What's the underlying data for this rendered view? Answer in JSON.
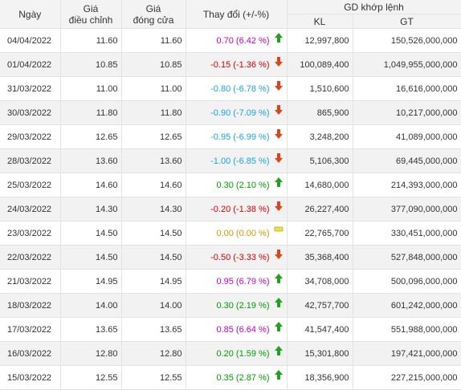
{
  "headers": {
    "date": "Ngày",
    "adj": [
      "Giá",
      "điều chỉnh"
    ],
    "close": [
      "Giá",
      "đóng cửa"
    ],
    "change": "Thay đổi (+/-%)",
    "matched": "GD khớp lệnh",
    "kl": "KL",
    "gt": "GT"
  },
  "colors": {
    "up": "#00a000",
    "down": "#dd0000",
    "ceiling": "#c400c4",
    "floor": "#1aa3e8",
    "reference": "#d99600"
  },
  "rows": [
    {
      "date": "04/04/2022",
      "adj": "11.60",
      "close": "11.60",
      "change": "0.70 (6.42 %)",
      "status": "ceil",
      "dir": "up",
      "kl": "12,997,800",
      "gt": "150,526,000,000"
    },
    {
      "date": "01/04/2022",
      "adj": "10.85",
      "close": "10.85",
      "change": "-0.15 (-1.36 %)",
      "status": "down",
      "dir": "down",
      "kl": "100,089,400",
      "gt": "1,049,955,000,000"
    },
    {
      "date": "31/03/2022",
      "adj": "11.00",
      "close": "11.00",
      "change": "-0.80 (-6.78 %)",
      "status": "floor",
      "dir": "down",
      "kl": "1,510,600",
      "gt": "16,616,000,000"
    },
    {
      "date": "30/03/2022",
      "adj": "11.80",
      "close": "11.80",
      "change": "-0.90 (-7.09 %)",
      "status": "floor",
      "dir": "down",
      "kl": "865,900",
      "gt": "10,217,000,000"
    },
    {
      "date": "29/03/2022",
      "adj": "12.65",
      "close": "12.65",
      "change": "-0.95 (-6.99 %)",
      "status": "floor",
      "dir": "down",
      "kl": "3,248,200",
      "gt": "41,089,000,000"
    },
    {
      "date": "28/03/2022",
      "adj": "13.60",
      "close": "13.60",
      "change": "-1.00 (-6.85 %)",
      "status": "floor",
      "dir": "down",
      "kl": "5,106,300",
      "gt": "69,445,000,000"
    },
    {
      "date": "25/03/2022",
      "adj": "14.60",
      "close": "14.60",
      "change": "0.30 (2.10 %)",
      "status": "up",
      "dir": "up",
      "kl": "14,680,000",
      "gt": "214,393,000,000"
    },
    {
      "date": "24/03/2022",
      "adj": "14.30",
      "close": "14.30",
      "change": "-0.20 (-1.38 %)",
      "status": "down",
      "dir": "down",
      "kl": "26,227,400",
      "gt": "377,090,000,000"
    },
    {
      "date": "23/03/2022",
      "adj": "14.50",
      "close": "14.50",
      "change": "0.00 (0.00 %)",
      "status": "ref",
      "dir": "flat",
      "kl": "22,765,700",
      "gt": "330,451,000,000"
    },
    {
      "date": "22/03/2022",
      "adj": "14.50",
      "close": "14.50",
      "change": "-0.50 (-3.33 %)",
      "status": "down",
      "dir": "down",
      "kl": "35,368,400",
      "gt": "527,848,000,000"
    },
    {
      "date": "21/03/2022",
      "adj": "14.95",
      "close": "14.95",
      "change": "0.95 (6.79 %)",
      "status": "ceil",
      "dir": "up",
      "kl": "34,708,000",
      "gt": "500,096,000,000"
    },
    {
      "date": "18/03/2022",
      "adj": "14.00",
      "close": "14.00",
      "change": "0.30 (2.19 %)",
      "status": "up",
      "dir": "up",
      "kl": "42,757,700",
      "gt": "601,242,000,000"
    },
    {
      "date": "17/03/2022",
      "adj": "13.65",
      "close": "13.65",
      "change": "0.85 (6.64 %)",
      "status": "ceil",
      "dir": "up",
      "kl": "41,547,400",
      "gt": "551,988,000,000"
    },
    {
      "date": "16/03/2022",
      "adj": "12.80",
      "close": "12.80",
      "change": "0.20 (1.59 %)",
      "status": "up",
      "dir": "up",
      "kl": "15,301,800",
      "gt": "197,421,000,000"
    },
    {
      "date": "15/03/2022",
      "adj": "12.55",
      "close": "12.55",
      "change": "0.35 (2.87 %)",
      "status": "up",
      "dir": "up",
      "kl": "18,356,900",
      "gt": "227,215,000,000"
    }
  ]
}
